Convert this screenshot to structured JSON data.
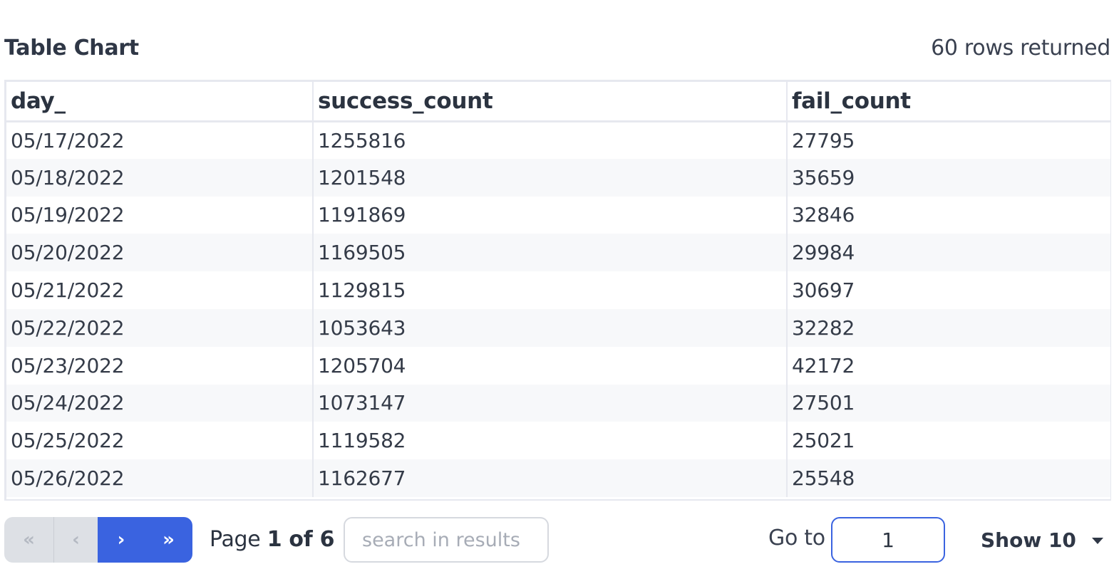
{
  "header": {
    "title": "Table Chart",
    "rows_returned": "60 rows returned"
  },
  "table": {
    "columns": [
      "day_",
      "success_count",
      "fail_count"
    ],
    "rows": [
      [
        "05/17/2022",
        "1255816",
        "27795"
      ],
      [
        "05/18/2022",
        "1201548",
        "35659"
      ],
      [
        "05/19/2022",
        "1191869",
        "32846"
      ],
      [
        "05/20/2022",
        "1169505",
        "29984"
      ],
      [
        "05/21/2022",
        "1129815",
        "30697"
      ],
      [
        "05/22/2022",
        "1053643",
        "32282"
      ],
      [
        "05/23/2022",
        "1205704",
        "42172"
      ],
      [
        "05/24/2022",
        "1073147",
        "27501"
      ],
      [
        "05/25/2022",
        "1119582",
        "25021"
      ],
      [
        "05/26/2022",
        "1162677",
        "25548"
      ]
    ]
  },
  "pagination": {
    "first_label": "«",
    "prev_label": "‹",
    "next_label": "›",
    "last_label": "»",
    "page_prefix": "Page",
    "page_status": "1 of 6",
    "search_placeholder": "search in results",
    "goto_label": "Go to",
    "goto_value": "1",
    "show_label": "Show 10"
  },
  "colors": {
    "accent": "#3a63e0",
    "disabled": "#dde0e5",
    "border": "#e6e8ef"
  }
}
